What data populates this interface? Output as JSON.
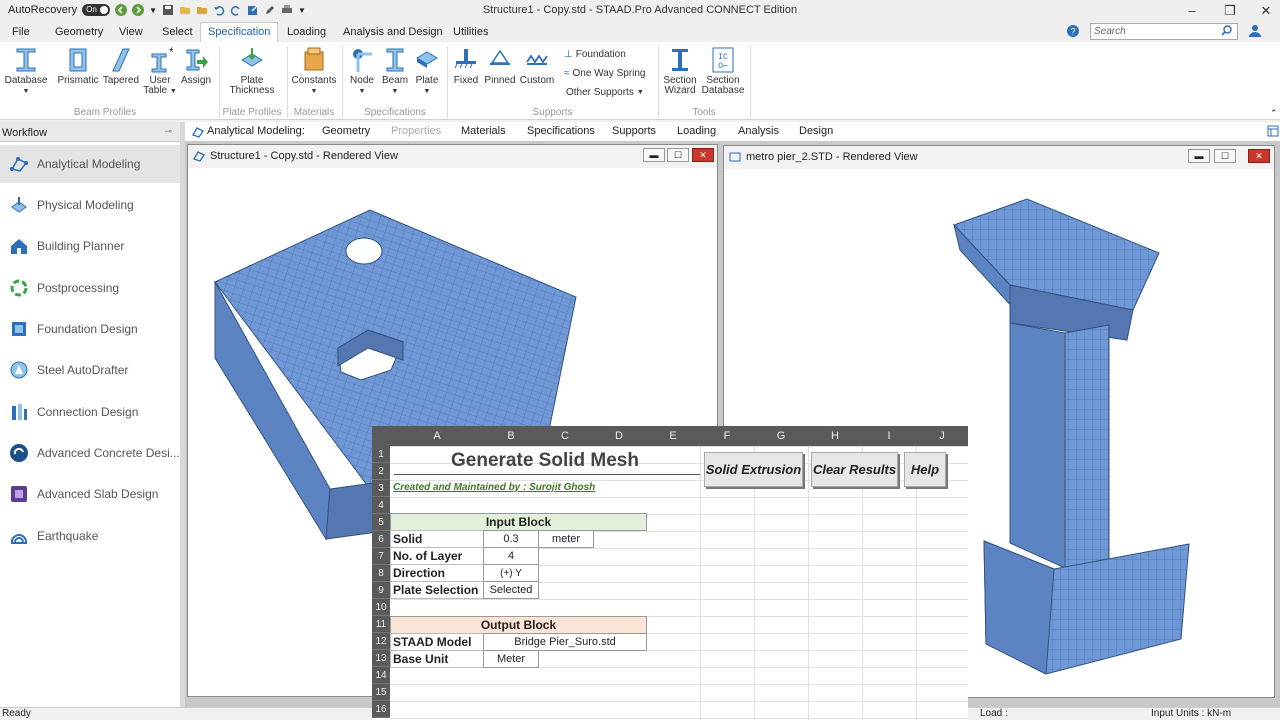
{
  "qat": {
    "autorecovery": "AutoRecovery",
    "toggle": "On"
  },
  "app_title": "Structure1 - Copy.std - STAAD.Pro Advanced CONNECT Edition",
  "tabs": [
    "File",
    "Geometry",
    "View",
    "Select",
    "Specification",
    "Loading",
    "Analysis and Design",
    "Utilities"
  ],
  "search_placeholder": "Search",
  "ribbon": {
    "database": "Database",
    "prismatic": "Prismatic",
    "tapered": "Tapered",
    "user_table": "User Table",
    "assign": "Assign",
    "plate_thickness": "Plate Thickness",
    "constants": "Constants",
    "node": "Node",
    "beam": "Beam",
    "plate": "Plate",
    "fixed": "Fixed",
    "pinned": "Pinned",
    "custom": "Custom",
    "foundation": "Foundation",
    "one_way_spring": "One Way Spring",
    "other_supports": "Other Supports",
    "section_wizard": "Section Wizard",
    "section_database": "Section Database",
    "groups": {
      "beam_profiles": "Beam Profiles",
      "plate_profiles": "Plate Profiles",
      "materials": "Materials",
      "specifications": "Specifications",
      "supports": "Supports",
      "tools": "Tools"
    }
  },
  "workflow": {
    "header": "Workflow",
    "items": [
      "Analytical Modeling",
      "Physical Modeling",
      "Building Planner",
      "Postprocessing",
      "Foundation Design",
      "Steel AutoDrafter",
      "Connection Design",
      "Advanced Concrete Desi...",
      "Advanced Slab Design",
      "Earthquake"
    ]
  },
  "workflow_tabs": {
    "label": "Analytical Modeling:",
    "items": [
      "Geometry",
      "Properties",
      "Materials",
      "Specifications",
      "Supports",
      "Loading",
      "Analysis",
      "Design"
    ]
  },
  "windows": {
    "left": "Structure1 - Copy.std - Rendered View",
    "right": "metro pier_2.STD - Rendered View"
  },
  "status": {
    "ready": "Ready",
    "load": "Load :",
    "input_units": "Input Units : kN-m"
  },
  "excel": {
    "columns": [
      "A",
      "B",
      "C",
      "D",
      "E",
      "F",
      "G",
      "H",
      "I",
      "J"
    ],
    "rows": [
      "1",
      "2",
      "3",
      "4",
      "5",
      "6",
      "7",
      "8",
      "9",
      "10",
      "11",
      "12",
      "13",
      "14",
      "15",
      "16"
    ],
    "title": "Generate Solid Mesh",
    "credit": "Created and Maintained by : Surojit Ghosh",
    "input_block": "Input Block",
    "solid_thickness_label": "Solid Thickness",
    "solid_thickness": "0.3",
    "thickness_unit": "meter",
    "layers_label": "No. of Layer",
    "layers": "4",
    "direction_label": "Direction",
    "direction": "(+) Y",
    "plate_sel_label": "Plate Selection",
    "plate_sel": "Selected",
    "output_block": "Output Block",
    "model_label": "STAAD Model",
    "model": "Bridge Pier_Suro.std",
    "unit_label": "Base Unit",
    "unit": "Meter",
    "btn_extrude": "Solid Extrusion",
    "btn_clear": "Clear Results",
    "btn_help": "Help"
  }
}
